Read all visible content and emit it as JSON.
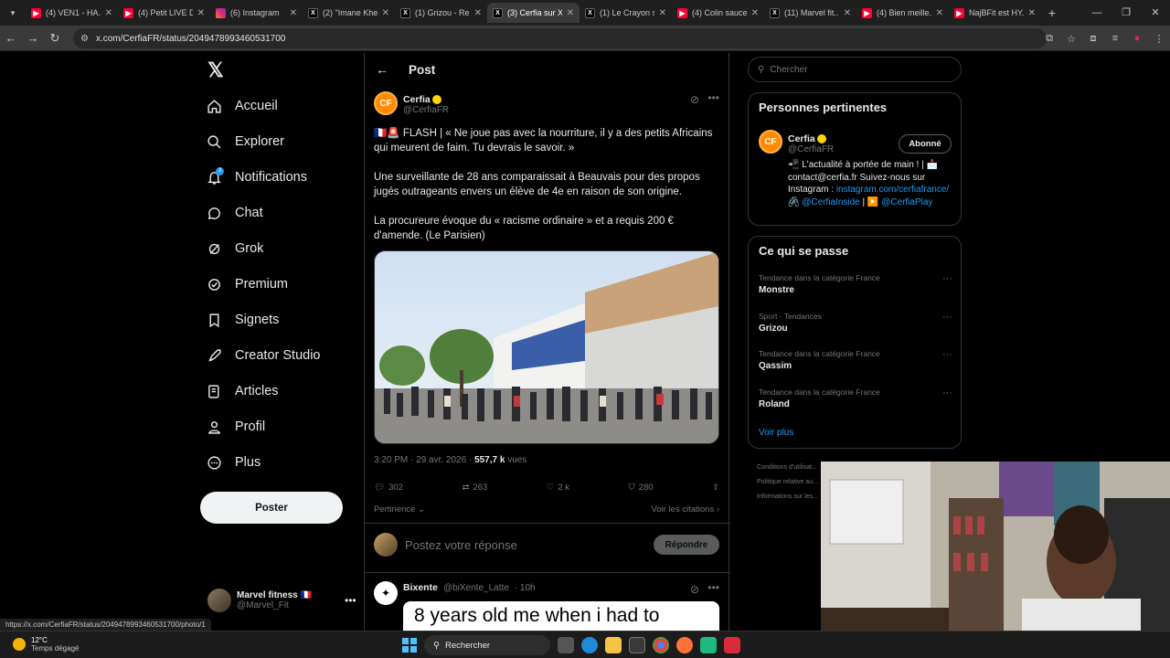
{
  "browser": {
    "tabs": [
      {
        "label": "(4) VEN1 - HA...",
        "icon": "youtube-icon",
        "active": false
      },
      {
        "label": "(4) Petit LIVE D...",
        "icon": "youtube-icon",
        "active": false
      },
      {
        "label": "(6) Instagram",
        "icon": "instagram-icon",
        "active": false
      },
      {
        "label": "(2) \"Imane Khe...",
        "icon": "x-icon",
        "active": false
      },
      {
        "label": "(1) Grizou - Re...",
        "icon": "x-icon",
        "active": false
      },
      {
        "label": "(3) Cerfia sur X...",
        "icon": "x-icon",
        "active": true
      },
      {
        "label": "(1) Le Crayon s...",
        "icon": "x-icon",
        "active": false
      },
      {
        "label": "(4) Colin sauce...",
        "icon": "youtube-icon",
        "active": false
      },
      {
        "label": "(11) Marvel fit...",
        "icon": "x-icon",
        "active": false
      },
      {
        "label": "(4) Bien meille...",
        "icon": "youtube-icon",
        "active": false
      },
      {
        "label": "NajBFit est HY...",
        "icon": "youtube-icon",
        "active": false
      }
    ],
    "url": "x.com/CerfiaFR/status/2049478993460531700",
    "status_url": "https://x.com/CerfiaFR/status/2049478993460531700/photo/1"
  },
  "nav": {
    "items": [
      {
        "label": "Accueil",
        "icon": "home-icon"
      },
      {
        "label": "Explorer",
        "icon": "search-icon"
      },
      {
        "label": "Notifications",
        "icon": "bell-icon",
        "badge": "3"
      },
      {
        "label": "Chat",
        "icon": "chat-icon"
      },
      {
        "label": "Grok",
        "icon": "grok-icon"
      },
      {
        "label": "Premium",
        "icon": "premium-icon"
      },
      {
        "label": "Signets",
        "icon": "bookmark-icon"
      },
      {
        "label": "Creator Studio",
        "icon": "rocket-icon"
      },
      {
        "label": "Articles",
        "icon": "article-icon"
      },
      {
        "label": "Profil",
        "icon": "profile-icon"
      },
      {
        "label": "Plus",
        "icon": "more-icon"
      }
    ],
    "post_button": "Poster",
    "account": {
      "name": "Marvel fitness 🇫🇷",
      "handle": "@Marvel_Fit"
    }
  },
  "post": {
    "header_title": "Post",
    "author": {
      "name": "Cerfia",
      "handle": "@CerfiaFR",
      "logo": "CF"
    },
    "text": {
      "p1": "🇫🇷🚨 FLASH | « Ne joue pas avec la nourriture, il y a des petits Africains qui meurent de faim. Tu devrais le savoir. »",
      "p2": "Une surveillante de 28 ans comparaissait à Beauvais pour des propos jugés outrageants envers un élève de 4e en raison de son origine.",
      "p3": "La procureure évoque du « racisme ordinaire » et a requis 200 € d'amende. (Le Parisien)"
    },
    "timestamp": "3:20 PM · 29 avr. 2026 · ",
    "views_count": "557,7 k",
    "views_label": " vues",
    "stats": {
      "replies": "302",
      "reposts": "263",
      "likes": "2 k",
      "bookmarks": "280"
    },
    "sort_label": "Pertinence ⌄",
    "quotes_label": "Voir les citations ›",
    "reply_placeholder": "Postez votre réponse",
    "reply_button": "Répondre"
  },
  "reply_tweet": {
    "name": "Bixente",
    "handle": "@biXente_Latte",
    "time": "· 10h",
    "meme_text": "8 years old me when i had to"
  },
  "sidebar": {
    "search_placeholder": "Chercher",
    "relevant": {
      "title": "Personnes pertinentes",
      "name": "Cerfia",
      "handle": "@CerfiaFR",
      "follow_state": "Abonné",
      "bio_line1": "📲 L'actualité à portée de main ! | 📩 contact@cerfia.fr Suivez-nous sur Instagram :",
      "bio_link1": "instagram.com/cerfiafrance/",
      "bio_mid": " 🖇️ ",
      "bio_link2": "@CerfiaInside",
      "bio_sep": " | ▶️ ",
      "bio_link3": "@CerfiaPlay"
    },
    "trends": {
      "title": "Ce qui se passe",
      "items": [
        {
          "category": "Tendance dans la catégorie France",
          "name": "Monstre"
        },
        {
          "category": "Sport · Tendances",
          "name": "Grizou"
        },
        {
          "category": "Tendance dans la catégorie France",
          "name": "Qassim"
        },
        {
          "category": "Tendance dans la catégorie France",
          "name": "Roland"
        }
      ],
      "see_more": "Voir plus"
    },
    "footer": [
      "Conditions d'utilisat...",
      "Politique relative au...",
      "Informations sur les..."
    ]
  },
  "taskbar": {
    "temperature": "12°C",
    "weather": "Temps dégagé",
    "search": "Rechercher"
  }
}
